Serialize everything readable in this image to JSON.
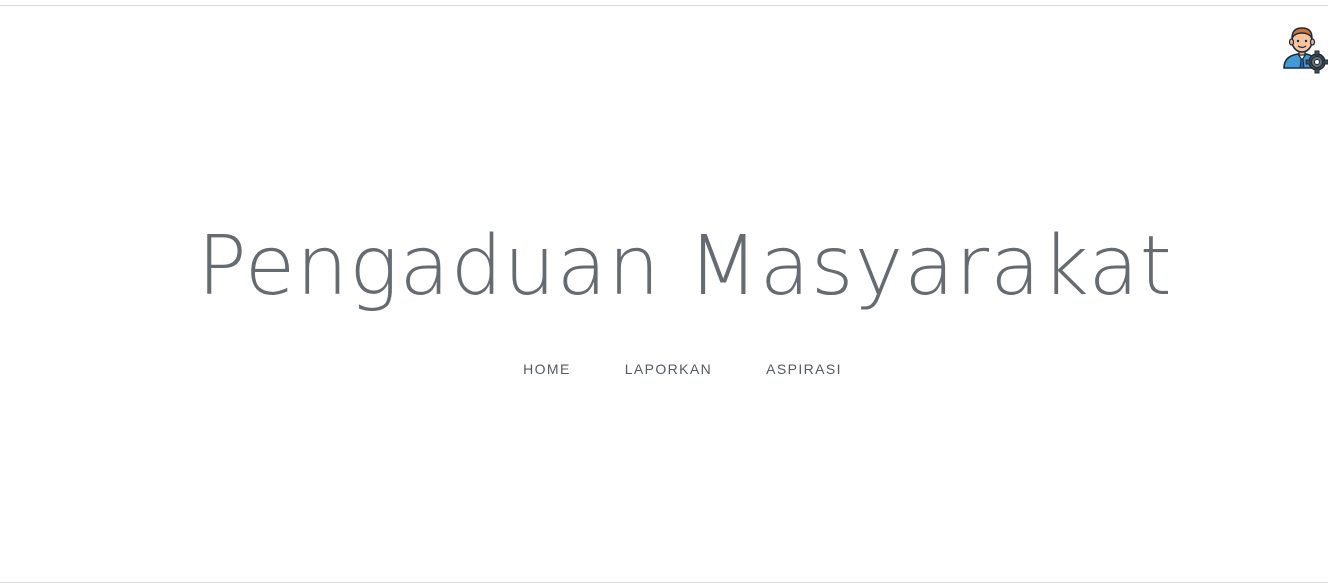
{
  "header": {
    "admin_icon": "admin-settings-avatar-icon"
  },
  "hero": {
    "title": "Pengaduan Masyarakat"
  },
  "nav": {
    "items": [
      {
        "label": "HOME"
      },
      {
        "label": "LAPORKAN"
      },
      {
        "label": "ASPIRASI"
      }
    ]
  },
  "colors": {
    "title": "#656b70",
    "nav_text": "#555b60",
    "background": "#ffffff",
    "border": "#dddddd"
  }
}
